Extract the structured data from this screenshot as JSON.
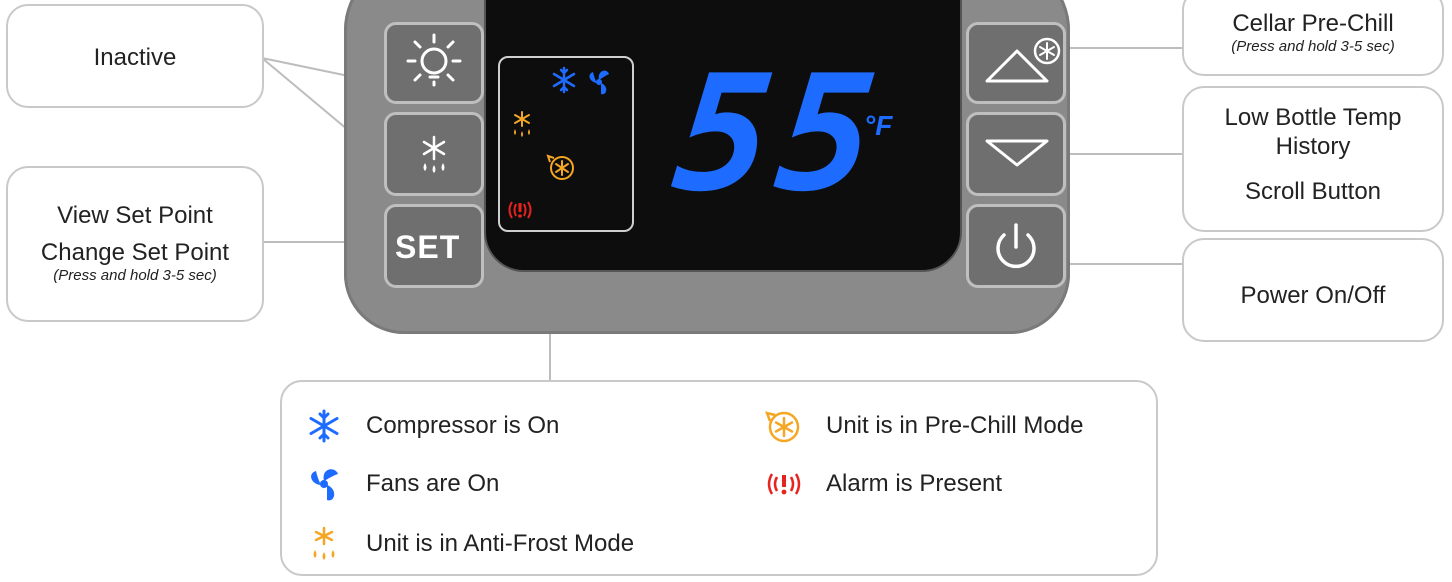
{
  "callouts": {
    "inactive": "Inactive",
    "set_view": "View Set Point",
    "set_change": "Change Set Point",
    "set_note": "(Press and hold 3-5 sec)",
    "prechill_title": "Cellar Pre-Chill",
    "prechill_note": "(Press and hold 3-5 sec)",
    "low_bottle_1": "Low Bottle Temp",
    "low_bottle_2": "History",
    "scroll": "Scroll Button",
    "power": "Power On/Off"
  },
  "display": {
    "temperature": "55",
    "unit": "°F",
    "digit_color": "#1E6BFF"
  },
  "buttons": {
    "set_label": "SET"
  },
  "legend": {
    "compressor": "Compressor is On",
    "fans": "Fans are On",
    "antifrost": "Unit is in Anti-Frost Mode",
    "prechill": "Unit is in Pre-Chill Mode",
    "alarm": "Alarm is Present"
  },
  "colors": {
    "blue": "#1E6BFF",
    "orange": "#F5A623",
    "red": "#E8231E"
  },
  "icons": [
    "light-icon",
    "anti-frost-icon",
    "set-label",
    "up-prechill-icon",
    "down-arrow-icon",
    "power-icon",
    "snowflake-icon",
    "fan-icon",
    "prechill-icon",
    "alarm-icon"
  ]
}
